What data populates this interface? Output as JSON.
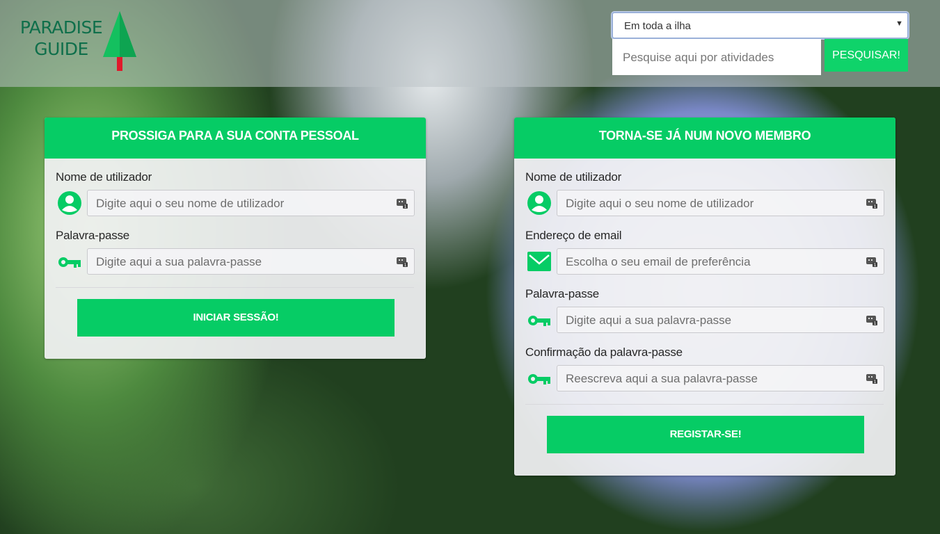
{
  "header": {
    "logo": {
      "line1": "PARADISE",
      "line2": "GUIDE"
    },
    "search": {
      "select_value": "Em toda a ilha",
      "placeholder": "Pesquise aqui por atividades",
      "button_label": "PESQUISAR!"
    }
  },
  "login": {
    "title": "PROSSIGA PARA A SUA CONTA PESSOAL",
    "fields": [
      {
        "label": "Nome de utilizador",
        "placeholder": "Digite aqui o seu nome de utilizador",
        "icon": "user-icon"
      },
      {
        "label": "Palavra-passe",
        "placeholder": "Digite aqui a sua palavra-passe",
        "icon": "key-icon"
      }
    ],
    "button_label": "INICIAR SESSÃO!"
  },
  "register": {
    "title": "TORNA-SE JÁ NUM NOVO MEMBRO",
    "fields": [
      {
        "label": "Nome de utilizador",
        "placeholder": "Digite aqui o seu nome de utilizador",
        "icon": "user-icon"
      },
      {
        "label": "Endereço de email",
        "placeholder": "Escolha o seu email de preferência",
        "icon": "envelope-icon"
      },
      {
        "label": "Palavra-passe",
        "placeholder": "Digite aqui a sua palavra-passe",
        "icon": "key-icon"
      },
      {
        "label": "Confirmação da palavra-passe",
        "placeholder": "Reescreva aqui a sua palavra-passe",
        "icon": "key-icon"
      }
    ],
    "button_label": "REGISTAR-SE!"
  },
  "colors": {
    "accent": "#06cc65",
    "logo": "#0f6f4b"
  }
}
